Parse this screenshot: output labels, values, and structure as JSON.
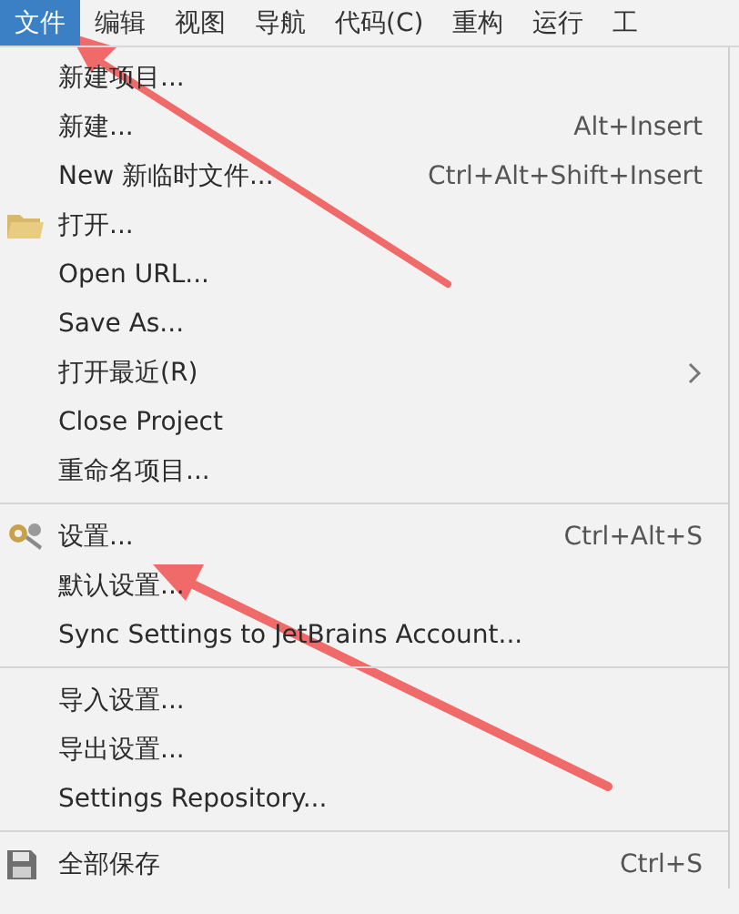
{
  "menubar": [
    {
      "label": "文件",
      "selected": true
    },
    {
      "label": "编辑",
      "selected": false
    },
    {
      "label": "视图",
      "selected": false
    },
    {
      "label": "导航",
      "selected": false
    },
    {
      "label": "代码(C)",
      "selected": false
    },
    {
      "label": "重构",
      "selected": false
    },
    {
      "label": "运行",
      "selected": false
    },
    {
      "label": "工",
      "selected": false
    }
  ],
  "menu": [
    {
      "kind": "item",
      "label": "新建项目..."
    },
    {
      "kind": "item",
      "label": "新建...",
      "shortcut": "Alt+Insert"
    },
    {
      "kind": "item",
      "label": "New 新临时文件...",
      "shortcut": "Ctrl+Alt+Shift+Insert"
    },
    {
      "kind": "folder",
      "label": "打开..."
    },
    {
      "kind": "item",
      "label": "Open URL..."
    },
    {
      "kind": "item",
      "label": "Save As..."
    },
    {
      "kind": "item",
      "label": "打开最近(R)",
      "submenu": true
    },
    {
      "kind": "item",
      "label": "Close Project"
    },
    {
      "kind": "item",
      "label": "重命名项目..."
    },
    {
      "kind": "separator"
    },
    {
      "kind": "wrench",
      "label": "设置...",
      "shortcut": "Ctrl+Alt+S"
    },
    {
      "kind": "item",
      "label": "默认设置..."
    },
    {
      "kind": "item",
      "label": "Sync Settings to JetBrains Account..."
    },
    {
      "kind": "separator"
    },
    {
      "kind": "item",
      "label": "导入设置..."
    },
    {
      "kind": "item",
      "label": "导出设置..."
    },
    {
      "kind": "item",
      "label": "Settings Repository..."
    },
    {
      "kind": "separator"
    },
    {
      "kind": "disk",
      "label": "全部保存",
      "shortcut": "Ctrl+S"
    }
  ]
}
